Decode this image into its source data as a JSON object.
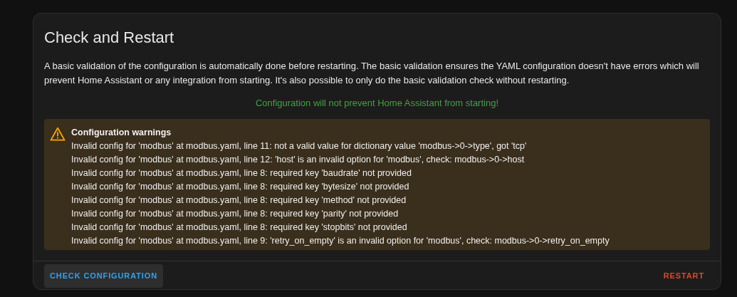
{
  "card": {
    "title": "Check and Restart",
    "description": "A basic validation of the configuration is automatically done before restarting. The basic validation ensures the YAML configuration doesn't have errors which will prevent Home Assistant or any integration from starting. It's also possible to only do the basic validation check without restarting.",
    "result": "Configuration will not prevent Home Assistant from starting!",
    "warnings": {
      "title": "Configuration warnings",
      "lines": [
        "Invalid config for 'modbus' at modbus.yaml, line 11: not a valid value for dictionary value 'modbus->0->type', got 'tcp'",
        "Invalid config for 'modbus' at modbus.yaml, line 12: 'host' is an invalid option for 'modbus', check: modbus->0->host",
        "Invalid config for 'modbus' at modbus.yaml, line 8: required key 'baudrate' not provided",
        "Invalid config for 'modbus' at modbus.yaml, line 8: required key 'bytesize' not provided",
        "Invalid config for 'modbus' at modbus.yaml, line 8: required key 'method' not provided",
        "Invalid config for 'modbus' at modbus.yaml, line 8: required key 'parity' not provided",
        "Invalid config for 'modbus' at modbus.yaml, line 8: required key 'stopbits' not provided",
        "Invalid config for 'modbus' at modbus.yaml, line 9: 'retry_on_empty' is an invalid option for 'modbus', check: modbus->0->retry_on_empty"
      ]
    },
    "actions": [
      {
        "label": "CHECK CONFIGURATION",
        "kind": "check"
      },
      {
        "label": "RESTART",
        "kind": "danger"
      }
    ]
  }
}
